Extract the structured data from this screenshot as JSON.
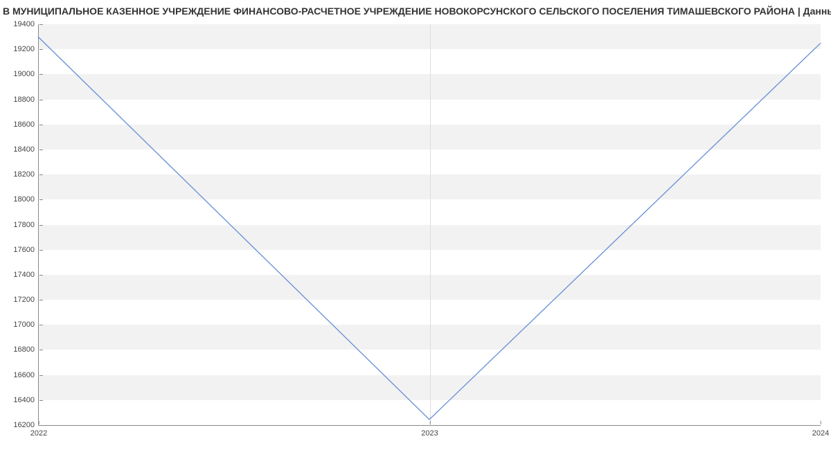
{
  "chart_data": {
    "type": "line",
    "title": "В МУНИЦИПАЛЬНОЕ КАЗЕННОЕ УЧРЕЖДЕНИЕ ФИНАНСОВО-РАСЧЕТНОЕ УЧРЕЖДЕНИЕ НОВОКОРСУНСКОГО СЕЛЬСКОГО ПОСЕЛЕНИЯ ТИМАШЕВСКОГО РАЙОНА | Данные п",
    "xlabel": "",
    "ylabel": "",
    "categories": [
      "2022",
      "2023",
      "2024"
    ],
    "x": [
      2022,
      2023,
      2024
    ],
    "values": [
      19300,
      16250,
      19250
    ],
    "ylim": [
      16200,
      19400
    ],
    "yticks": [
      16200,
      16400,
      16600,
      16800,
      17000,
      17200,
      17400,
      17600,
      17800,
      18000,
      18200,
      18400,
      18600,
      18800,
      19000,
      19200,
      19400
    ],
    "xticks": [
      "2022",
      "2023",
      "2024"
    ],
    "line_color": "#6890d8"
  }
}
